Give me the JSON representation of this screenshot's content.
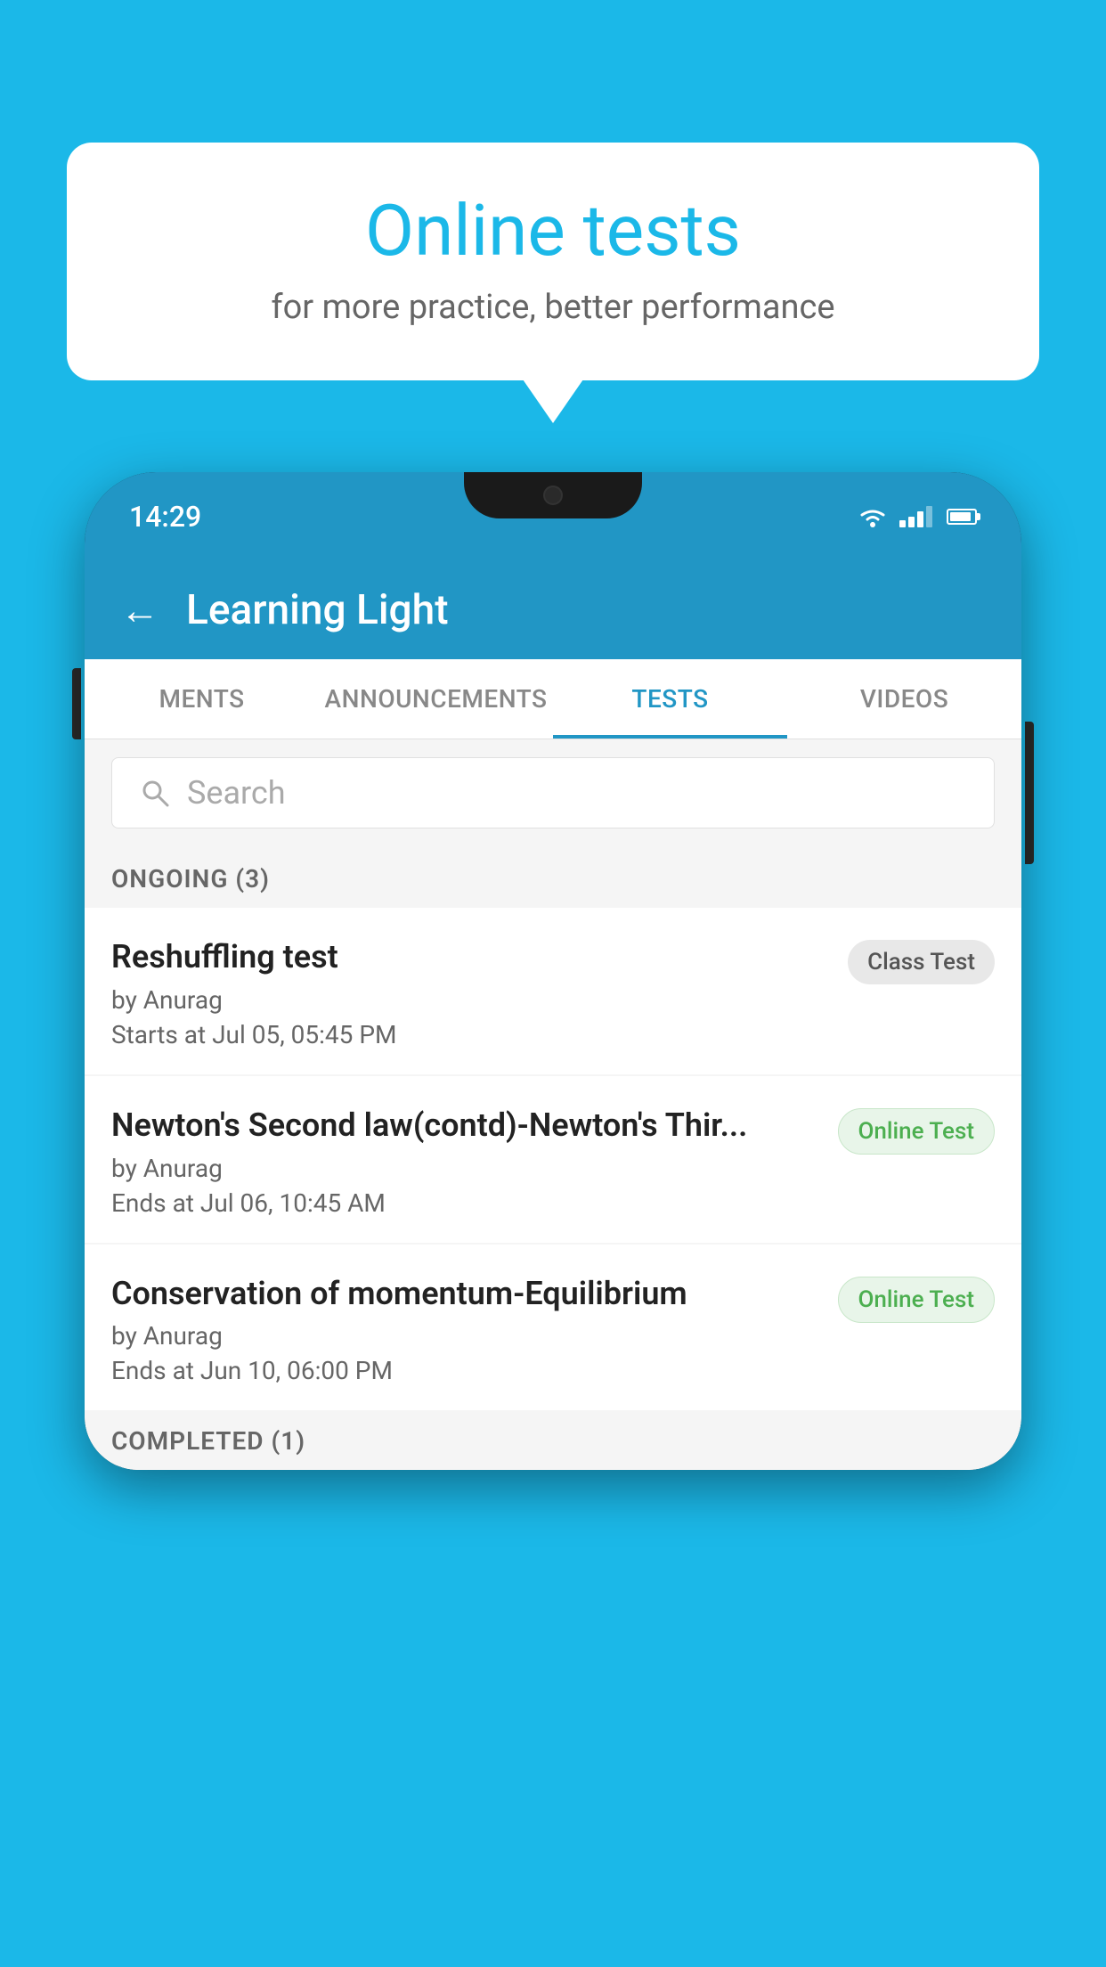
{
  "background_color": "#1BB8E8",
  "bubble": {
    "title": "Online tests",
    "subtitle": "for more practice, better performance"
  },
  "phone": {
    "status_bar": {
      "time": "14:29"
    },
    "app_header": {
      "title": "Learning Light",
      "back_label": "←"
    },
    "tabs": [
      {
        "label": "MENTS",
        "active": false
      },
      {
        "label": "ANNOUNCEMENTS",
        "active": false
      },
      {
        "label": "TESTS",
        "active": true
      },
      {
        "label": "VIDEOS",
        "active": false
      }
    ],
    "search": {
      "placeholder": "Search"
    },
    "sections": [
      {
        "title": "ONGOING (3)",
        "tests": [
          {
            "name": "Reshuffling test",
            "author": "by Anurag",
            "date": "Starts at  Jul 05, 05:45 PM",
            "badge": "Class Test",
            "badge_type": "class"
          },
          {
            "name": "Newton's Second law(contd)-Newton's Thir...",
            "author": "by Anurag",
            "date": "Ends at  Jul 06, 10:45 AM",
            "badge": "Online Test",
            "badge_type": "online"
          },
          {
            "name": "Conservation of momentum-Equilibrium",
            "author": "by Anurag",
            "date": "Ends at  Jun 10, 06:00 PM",
            "badge": "Online Test",
            "badge_type": "online"
          }
        ]
      },
      {
        "title": "COMPLETED (1)",
        "tests": []
      }
    ]
  }
}
